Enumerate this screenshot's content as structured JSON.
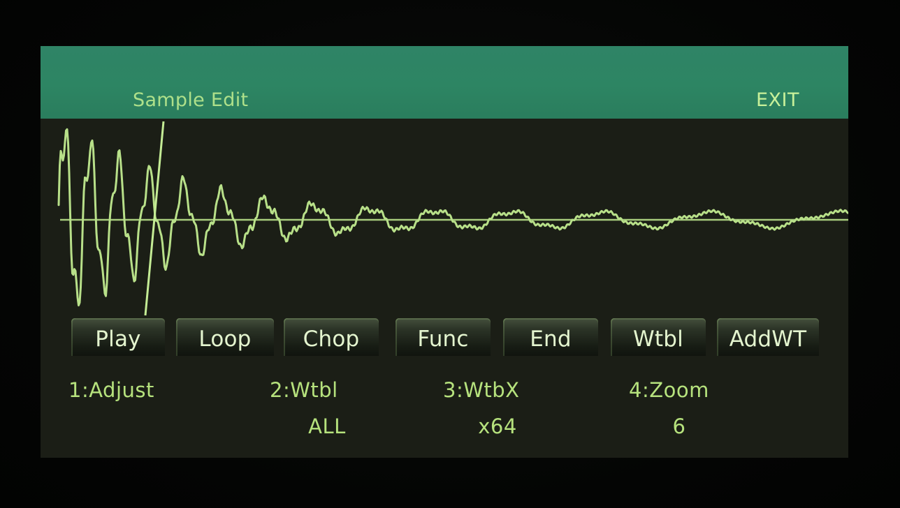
{
  "header": {
    "title": "Sample Edit",
    "exit_label": "EXIT"
  },
  "colors": {
    "header_bg": "#2d8563",
    "waveform": "#b8e089",
    "text": "#b6e27d",
    "screen_bg": "#1b1e16"
  },
  "softkeys": [
    {
      "label": "Play"
    },
    {
      "label": "Loop"
    },
    {
      "label": "Chop"
    },
    {
      "label": "Func"
    },
    {
      "label": "End"
    },
    {
      "label": "Wtbl"
    },
    {
      "label": "AddWT"
    }
  ],
  "params": [
    {
      "label": "1:Adjust",
      "value": ""
    },
    {
      "label": "2:Wtbl",
      "value": "ALL"
    },
    {
      "label": "3:WtbX",
      "value": "x64"
    },
    {
      "label": "4:Zoom",
      "value": "6"
    }
  ]
}
